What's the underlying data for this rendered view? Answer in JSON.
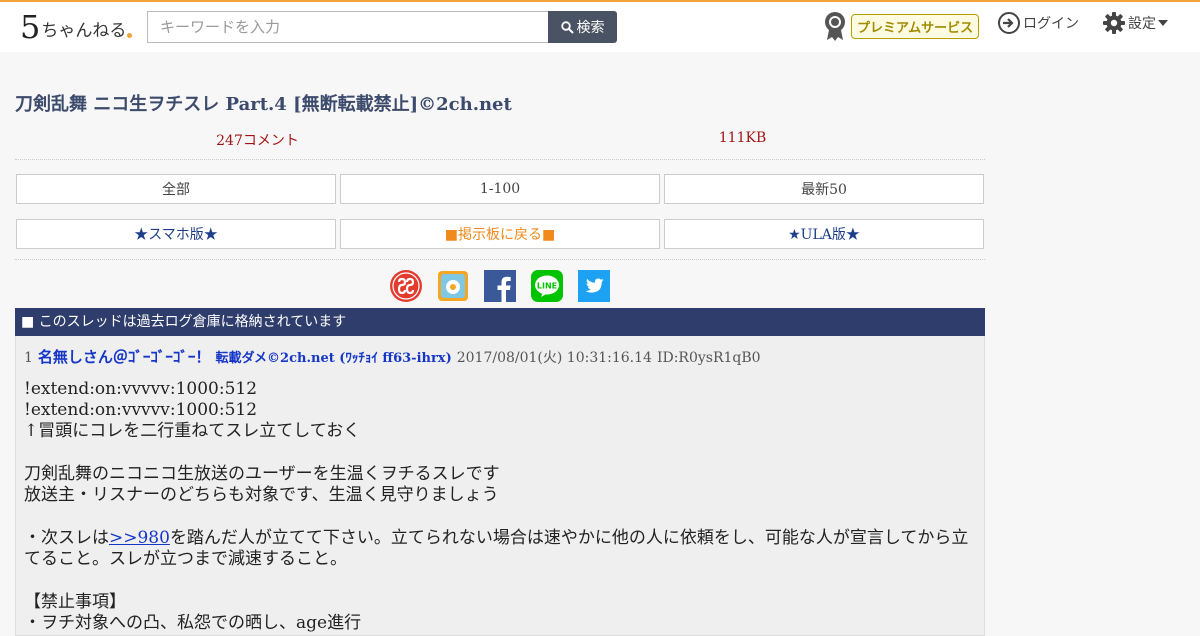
{
  "header": {
    "logo": {
      "five": "5",
      "rest": "ちゃんねる"
    },
    "search": {
      "placeholder": "キーワードを入力",
      "button_label": "検索"
    },
    "premium_label": "プレミアムサービス",
    "login_label": "ログイン",
    "settings_label": "設定"
  },
  "thread": {
    "title": "刀剣乱舞 ニコ生ヲチスレ Part.4 [無断転載禁止]©2ch.net",
    "comments": "247コメント",
    "size": "111KB"
  },
  "nav": {
    "all": "全部",
    "range": "1-100",
    "latest": "最新50",
    "smartphone": "★スマホ版★",
    "back_to_board": "■掲示板に戻る■",
    "ula": "★ULA版★"
  },
  "share": {
    "icons": [
      "ss-icon",
      "bookmark-icon",
      "facebook-icon",
      "line-icon",
      "twitter-icon"
    ],
    "colors": {
      "facebook": "#3b5998",
      "line": "#00c300",
      "twitter": "#1da1f2",
      "ss": "#e33b2e"
    }
  },
  "archive_notice": "■ このスレッドは過去ログ倉庫に格納されています",
  "post": {
    "number": "1",
    "name": "名無しさん＠ｺﾞｰｺﾞｰｺﾞｰ！",
    "trip": "転載ダメ©2ch.net (ﾜｯﾁｮｲ ff63-ihrx)",
    "date": "2017/08/01(火) 10:31:16.14",
    "id": "ID:R0ysR1qB0",
    "lines": {
      "l1": "!extend:on:vvvvv:1000:512",
      "l2": "!extend:on:vvvvv:1000:512",
      "l3": "↑冒頭にコレを二行重ねてスレ立てしておく",
      "l4": "刀剣乱舞のニコニコ生放送のユーザーを生温くヲチるスレです",
      "l5": "放送主・リスナーのどちらも対象です、生温く見守りましょう",
      "l6a": "・次スレは",
      "l6anchor": ">>980",
      "l6b": "を踏んだ人が立てて下さい。立てられない場合は速やかに他の人に依頼をし、可能な人が宣言してから立てること。スレが立つまで減速すること。",
      "l7": "【禁止事項】",
      "l8": "・ヲチ対象への凸、私怨での晒し、age進行"
    }
  }
}
